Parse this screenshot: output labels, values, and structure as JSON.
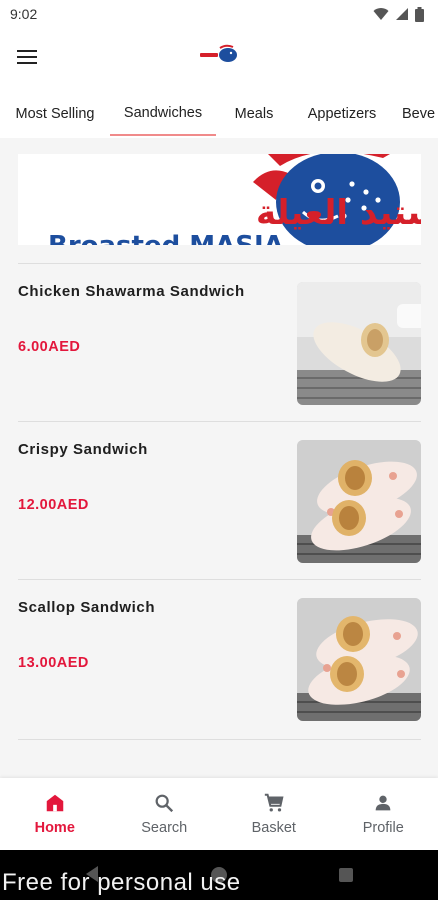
{
  "status_bar": {
    "time": "9:02"
  },
  "tabs": [
    {
      "label": "Most Selling",
      "active": false
    },
    {
      "label": "Sandwiches",
      "active": true
    },
    {
      "label": "Meals",
      "active": false
    },
    {
      "label": "Appetizers",
      "active": false
    },
    {
      "label": "Beve",
      "active": false
    }
  ],
  "banner": {
    "arabic_text": "بروستيد العيلة",
    "latin_text": "Broasted MASIA"
  },
  "products": [
    {
      "name": "Chicken Shawarma Sandwich",
      "price": "6.00AED"
    },
    {
      "name": "Crispy Sandwich",
      "price": "12.00AED"
    },
    {
      "name": "Scallop Sandwich",
      "price": "13.00AED"
    }
  ],
  "bottom_nav": [
    {
      "label": "Home",
      "icon": "home-icon",
      "active": true
    },
    {
      "label": "Search",
      "icon": "search-icon",
      "active": false
    },
    {
      "label": "Basket",
      "icon": "cart-icon",
      "active": false
    },
    {
      "label": "Profile",
      "icon": "person-icon",
      "active": false
    }
  ],
  "watermark": "Free for personal use",
  "colors": {
    "accent": "#e3173c",
    "tab_indicator": "#f08a8a",
    "content_bg": "#f5f5f5",
    "banner_blue": "#1d4e9e",
    "banner_red": "#d5202a"
  }
}
